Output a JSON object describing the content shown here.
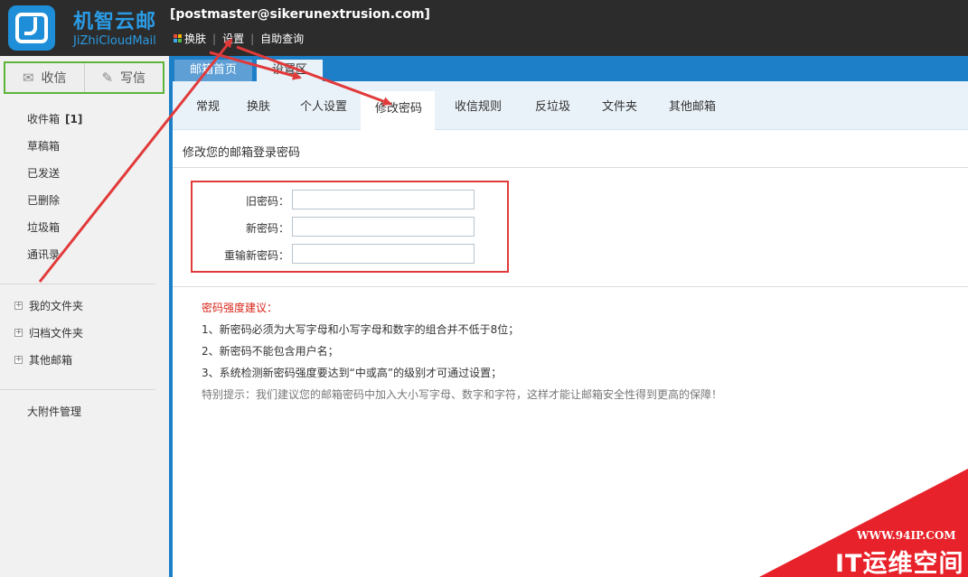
{
  "brand": {
    "name": "机智云邮",
    "sub": "JiZhiCloudMail"
  },
  "account": "[postmaster@sikerunextrusion.com]",
  "toplinks": {
    "skin": "换肤",
    "settings": "设置",
    "help": "自助查询"
  },
  "compose": {
    "receive": "收信",
    "write": "写信"
  },
  "nav": {
    "inbox": "收件箱",
    "inbox_count": "[1]",
    "drafts": "草稿箱",
    "sent": "已发送",
    "deleted": "已删除",
    "junk": "垃圾箱",
    "contacts": "通讯录"
  },
  "tree": {
    "my_folders": "我的文件夹",
    "archive": "归档文件夹",
    "other_mail": "其他邮箱"
  },
  "attachments": "大附件管理",
  "main_tabs": {
    "home": "邮箱首页",
    "settings": "设置区"
  },
  "subtabs": [
    "常规",
    "换肤",
    "个人设置",
    "修改密码",
    "收信规则",
    "反垃圾",
    "文件夹",
    "其他邮箱"
  ],
  "section_title": "修改您的邮箱登录密码",
  "form": {
    "old_label": "旧密码：",
    "new_label": "新密码：",
    "confirm_label": "重输新密码：",
    "old_value": "",
    "new_value": "",
    "confirm_value": ""
  },
  "tips": {
    "title": "密码强度建议：",
    "items": [
      "1、新密码必须为大写字母和小写字母和数字的组合并不低于8位；",
      "2、新密码不能包含用户名；",
      "3、系统检测新密码强度要达到“中或高”的级别才可通过设置；"
    ],
    "special": "特别提示：我们建议您的邮箱密码中加入大小写字母、数字和字符，这样才能让邮箱安全性得到更高的保障！"
  },
  "watermark": {
    "url": "WWW.94IP.COM",
    "text": "IT运维空间"
  },
  "colors": {
    "accent": "#1c7fc8",
    "brand": "#2a9be4",
    "alert": "#e13a3a",
    "compose_border": "#5cb53a"
  }
}
